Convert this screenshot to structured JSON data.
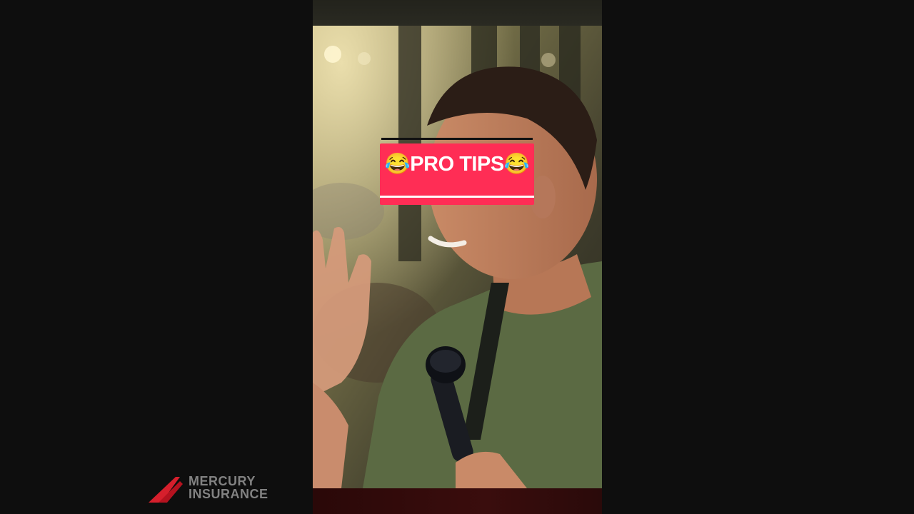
{
  "caption": {
    "text": "😂PRO TIPS😂",
    "background_color": "#ff2d55",
    "text_color": "#ffffff"
  },
  "sponsor": {
    "line1": "MERCURY",
    "line2": "INSURANCE",
    "accent_color": "#d61f2c"
  },
  "scene": {
    "shirt_color": "#5b6a43",
    "microphone": "microphone-icon"
  }
}
